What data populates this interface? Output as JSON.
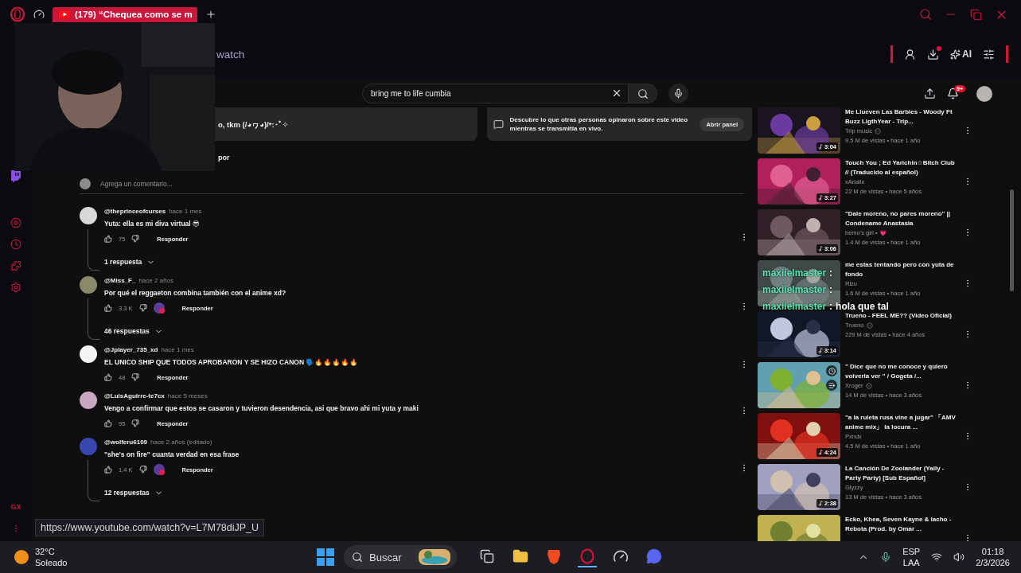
{
  "browser": {
    "tab": {
      "title": "(179) “Chequea como se m",
      "selected": true
    },
    "address": "watch",
    "ai_label": "AI",
    "sidebar_label": "GX"
  },
  "search": {
    "value": "bring me to life cumbia"
  },
  "notifications": {
    "badge": "9+"
  },
  "top_cards": [
    {
      "text": "o, tkm (/◕ヮ◕)/*:･ﾟ✧"
    },
    {
      "text": "Descubre lo que otras personas opinaron sobre este video mientras se transmitía en vivo.",
      "button": "Abrir panel"
    }
  ],
  "sort_label": "por",
  "add_comment": {
    "placeholder": "Agrega un comentario..."
  },
  "comments": [
    {
      "user": "@theprinceofcurses",
      "time": "hace 1 mes",
      "text": "Yuta: ella es mi diva virtual 😎",
      "likes": "75",
      "creator_heart": false,
      "reply_label": "Responder",
      "replies": "1 respuesta"
    },
    {
      "user": "@Miss_F_",
      "time": "hace 2 años",
      "text": "Por qué el reggaeton combina también con el anime xd?",
      "likes": "3.3 K",
      "creator_heart": true,
      "reply_label": "Responder",
      "replies": "46 respuestas"
    },
    {
      "user": "@Jplayer_735_xd",
      "time": "hace 1 mes",
      "text": "EL UNICO SHIP QUE TODOS APROBARON Y SE HIZO CANON 🗣️🔥🔥🔥🔥🔥",
      "likes": "48",
      "creator_heart": false,
      "reply_label": "Responder"
    },
    {
      "user": "@LuisAguirre-te7cx",
      "time": "hace 5 meses",
      "text": "Vengo a confirmar que estos se casaron y tuvieron desendencia, asi que bravo ahi mi yuta y maki",
      "likes": "95",
      "creator_heart": false,
      "reply_label": "Responder"
    },
    {
      "user": "@wolferu6109",
      "time": "hace 2 años (editado)",
      "text": "\"she's on fire\" cuanta verdad en esa frase",
      "likes": "1.4 K",
      "creator_heart": true,
      "reply_label": "Responder",
      "replies": "12 respuestas"
    }
  ],
  "recommendations": [
    {
      "title": "Me Llueven Las Barbies - Woody Ft Buzz LigthYear - Trip...",
      "channel": "Trip music",
      "verified": true,
      "meta": "9.5 M de vistas • hace 1 año",
      "duration": "3:04",
      "hovered": false
    },
    {
      "title": "Touch You ; Ed Yarichin☆Bitch Club // (Traducido al español)",
      "channel": "xArialix",
      "verified": false,
      "meta": "22 M de vistas • hace 5 años",
      "duration": "3:27",
      "hovered": false
    },
    {
      "title": "\"Dale moreno, no pares moreno\" || Condename Anastasia",
      "channel": "bemo's girl • 💗",
      "verified": false,
      "meta": "1.4 M de vistas • hace 1 año",
      "duration": "3:06",
      "hovered": false
    },
    {
      "title": "me estas tentando pero con yuta de fondo",
      "channel": "Rizu",
      "verified": false,
      "meta": "1.6 M de vistas • hace 1 año",
      "hovered": false
    },
    {
      "title": "Trueno - FEEL ME?? (Video Oficial)",
      "channel": "Trueno",
      "verified": true,
      "meta": "229 M de vistas • hace 4 años",
      "duration": "3:14",
      "hovered": false
    },
    {
      "title": "\" Dice que no me conoce y quiero volverla ver \" / Gogeta /...",
      "channel": "Xroger",
      "verified": true,
      "meta": "14 M de vistas • hace 3 años",
      "hovered": true
    },
    {
      "title": "\"a la ruleta rusa vine a jugar\" 「AMV anime mix」 la locura ...",
      "channel": "Pxndx",
      "verified": false,
      "meta": "4.5 M de vistas • hace 1 año",
      "duration": "4:24",
      "hovered": false
    },
    {
      "title": "La Canción De Zoolander (Yally - Party Party) [Sub Español]",
      "channel": "Glyzzy",
      "verified": false,
      "meta": "13 M de vistas • hace 3 años",
      "duration": "2:38",
      "hovered": false
    },
    {
      "title": "Ecko, Khea, Seven Kayne & lacho - Rebota (Prod. by Omar ...",
      "hovered": false
    }
  ],
  "chat_overlay": [
    {
      "user": "maxiielmaster",
      "separator": ":"
    },
    {
      "user": "maxiielmaster",
      "separator": ":"
    },
    {
      "user": "maxiielmaster",
      "separator": ":",
      "message": "hola que tal"
    }
  ],
  "status_url": "https://www.youtube.com/watch?v=L7M78diJP_U",
  "taskbar": {
    "temperature": "32°C",
    "weather": "Soleado",
    "search_placeholder": "Buscar",
    "language": "ESP",
    "layout": "LAA",
    "time": "01:18",
    "date": "2/3/2026"
  }
}
